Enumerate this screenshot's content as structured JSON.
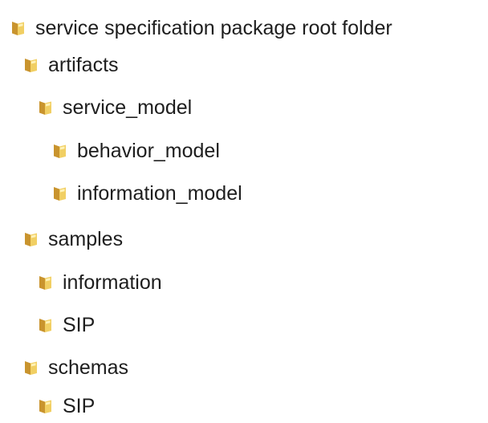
{
  "tree": {
    "root": {
      "label": "service specification package root folder",
      "icon": "folder-icon"
    },
    "artifacts": {
      "label": "artifacts",
      "icon": "folder-icon"
    },
    "service_model": {
      "label": "service_model",
      "icon": "folder-icon"
    },
    "behavior_model": {
      "label": "behavior_model",
      "icon": "folder-icon"
    },
    "information_model": {
      "label": "information_model",
      "icon": "folder-icon"
    },
    "samples": {
      "label": "samples",
      "icon": "folder-icon"
    },
    "information": {
      "label": "information",
      "icon": "folder-icon"
    },
    "samples_sip": {
      "label": "SIP",
      "icon": "folder-icon"
    },
    "schemas": {
      "label": "schemas",
      "icon": "folder-icon"
    },
    "schemas_sip": {
      "label": "SIP",
      "icon": "folder-icon"
    }
  },
  "colors": {
    "folder_front": "#f1cf63",
    "folder_back": "#c9942e",
    "folder_highlight": "#fff2b8",
    "text": "#1e1e1e"
  }
}
